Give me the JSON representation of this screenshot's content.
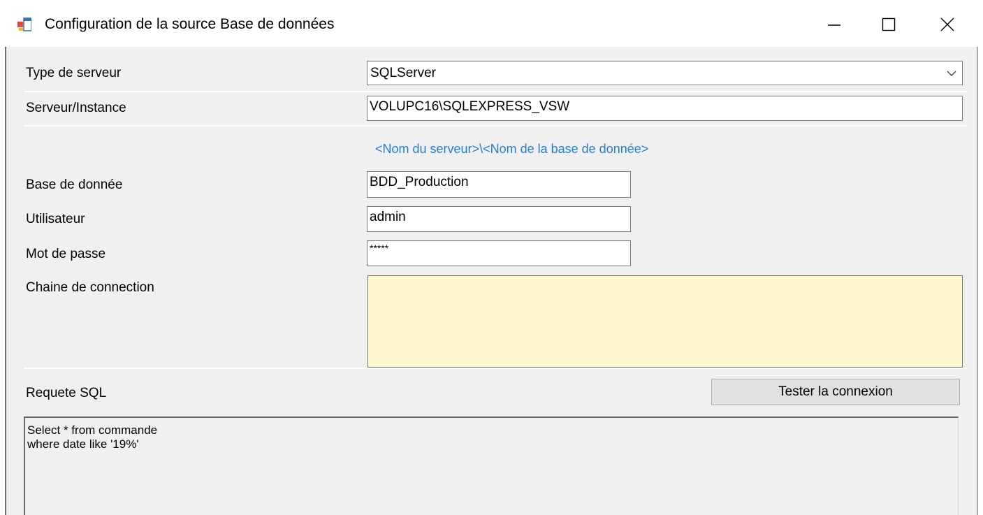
{
  "window": {
    "title": "Configuration de la source Base de données",
    "icon": "app-window-icon",
    "controls": [
      "minimize-icon",
      "maximize-icon",
      "close-icon"
    ]
  },
  "form": {
    "server_type": {
      "label": "Type de serveur",
      "value": "SQLServer"
    },
    "server_instance": {
      "label": "Serveur/Instance",
      "value": "VOLUPC16\\SQLEXPRESS_VSW"
    },
    "hint": "<Nom du serveur>\\<Nom de la base de donnée>",
    "database": {
      "label": "Base de donnée",
      "value": "BDD_Production"
    },
    "user": {
      "label": "Utilisateur",
      "value": "admin"
    },
    "password": {
      "label": "Mot de passe",
      "value": "*****"
    },
    "connection_string": {
      "label": "Chaine de connection",
      "value": ""
    },
    "sql": {
      "label": "Requete SQL",
      "lines": [
        "Select * from commande",
        "where date like '19%'"
      ]
    },
    "test_button": "Tester la connexion"
  },
  "colors": {
    "hint": "#1f7ed6",
    "connection_box": "#fff8cc",
    "dialog_bg": "#f0f0f0"
  }
}
